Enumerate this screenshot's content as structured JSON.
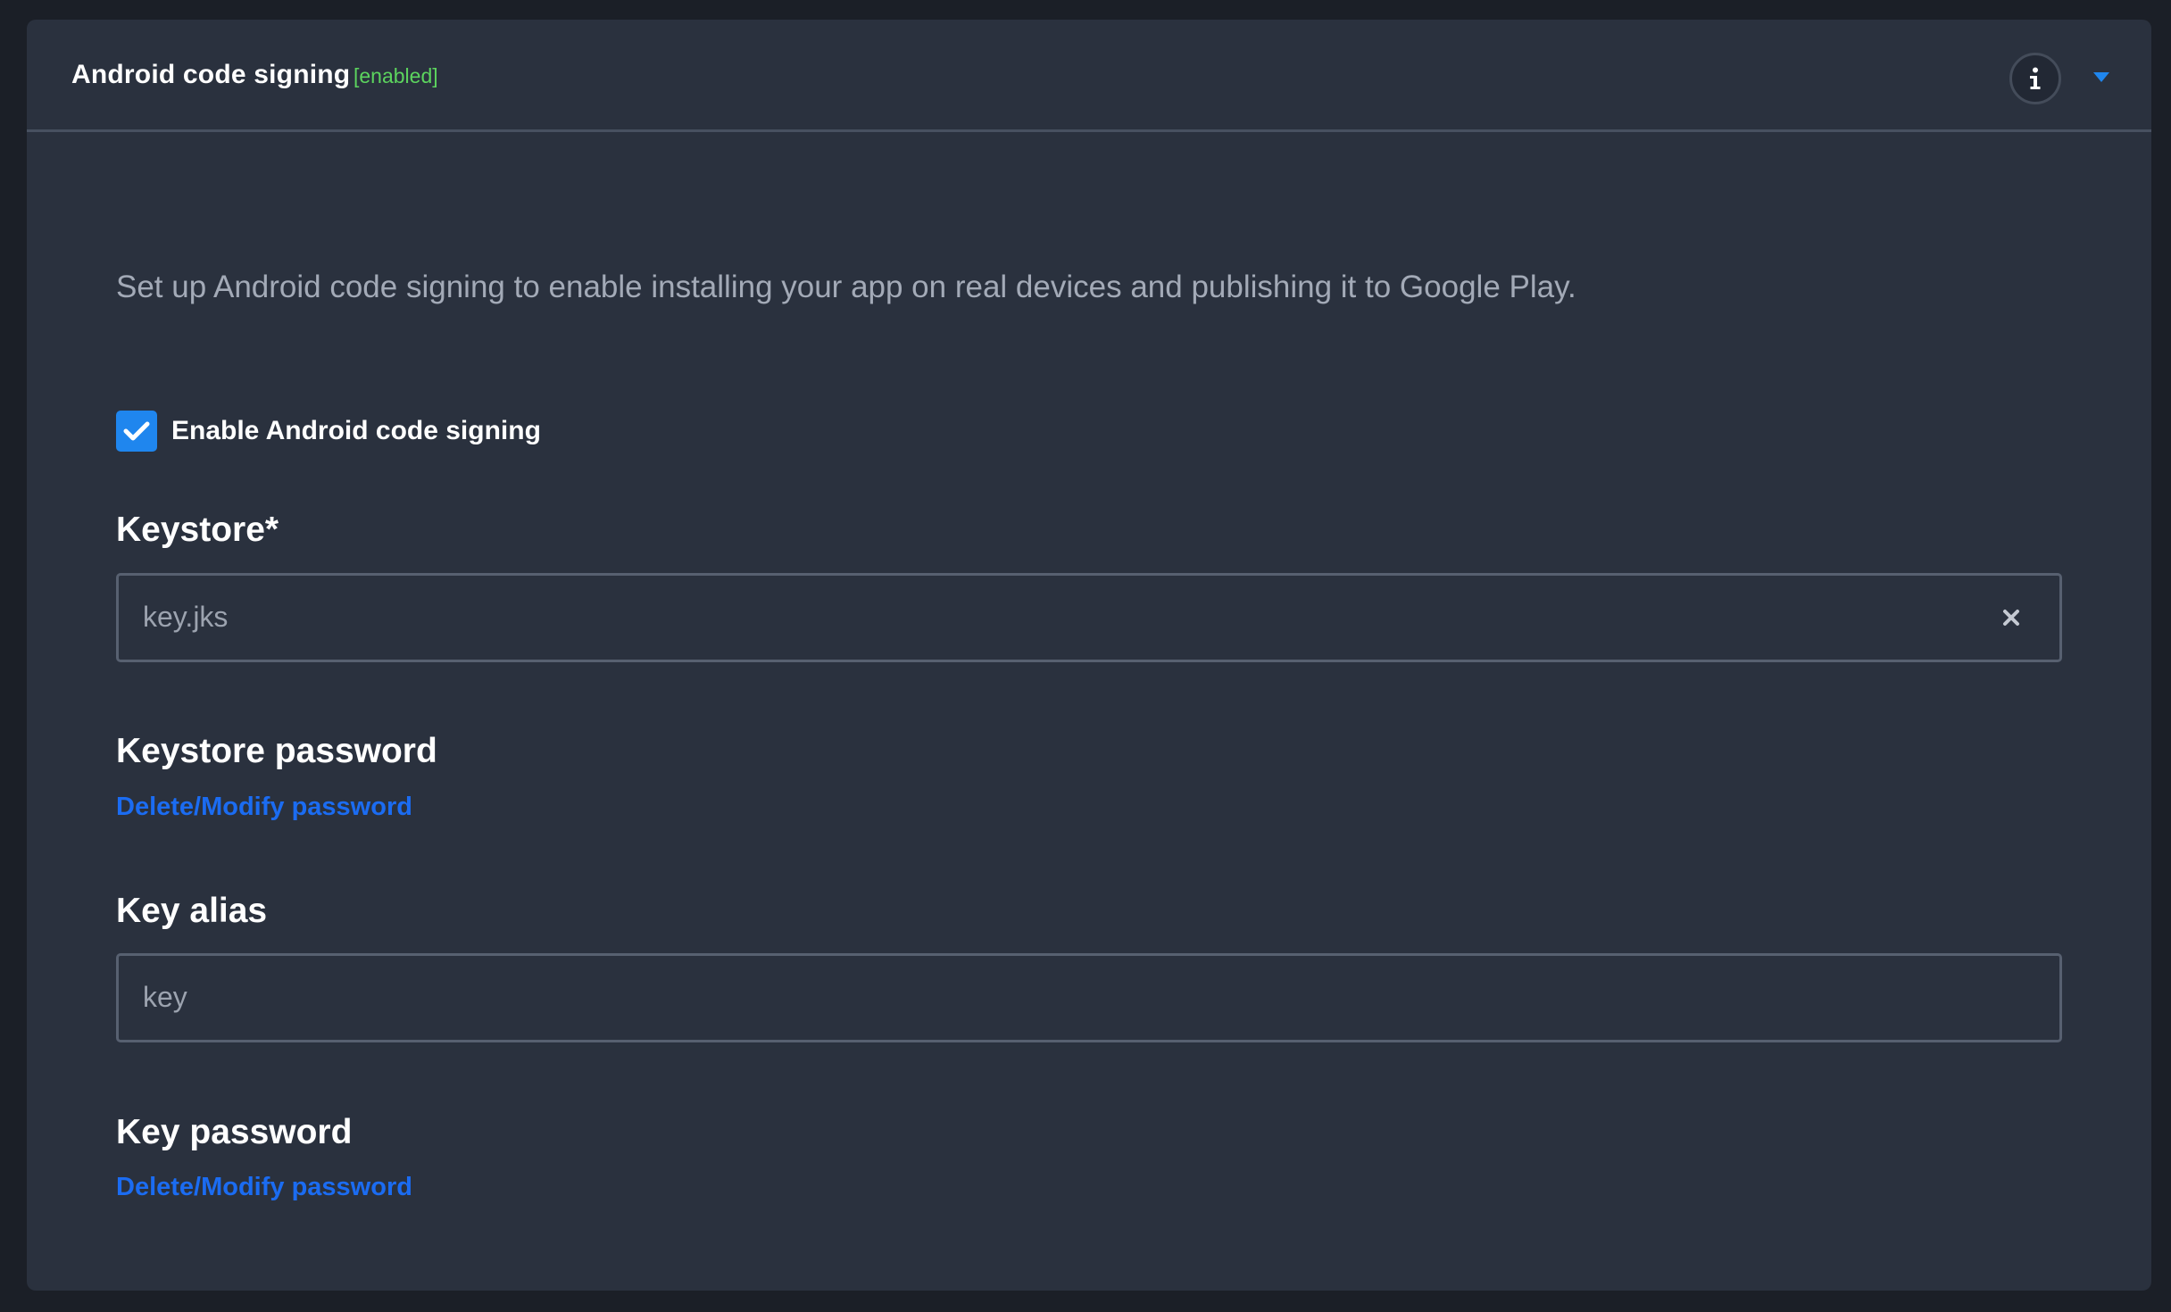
{
  "panel": {
    "title": "Android code signing",
    "status": "[enabled]",
    "info_icon": "info-icon",
    "toggle_icon": "chevron-down-icon"
  },
  "description": "Set up Android code signing to enable installing your app on real devices and publishing it to Google Play.",
  "enable_checkbox": {
    "label": "Enable Android code signing",
    "checked": true
  },
  "keystore": {
    "label": "Keystore*",
    "value": "key.jks",
    "clear_icon": "close-icon"
  },
  "keystore_password": {
    "label": "Keystore password",
    "link": "Delete/Modify password"
  },
  "key_alias": {
    "label": "Key alias",
    "value": "key"
  },
  "key_password": {
    "label": "Key password",
    "link": "Delete/Modify password"
  },
  "colors": {
    "background": "#1b1f27",
    "panel": "#2a313e",
    "accent": "#1f86ee",
    "link": "#1b6cf2",
    "status_green": "#5cd45e"
  }
}
